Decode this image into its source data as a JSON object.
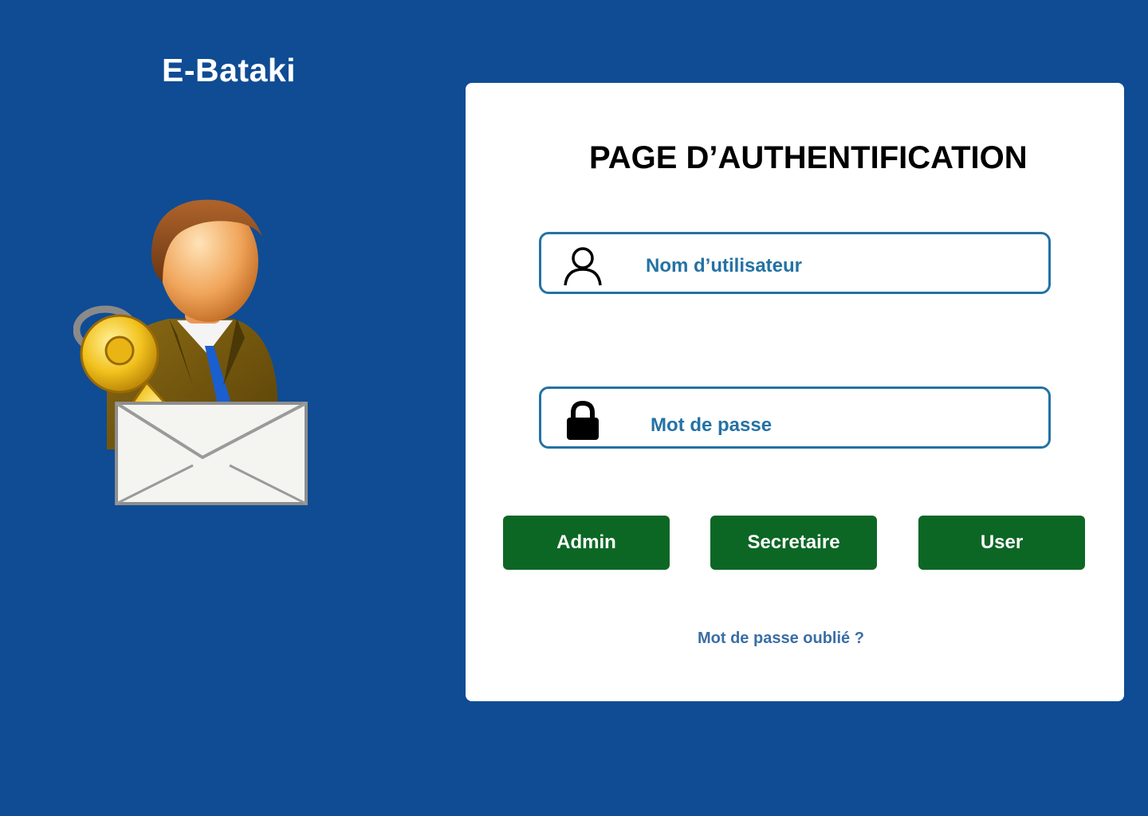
{
  "brand": {
    "name": "E-Bataki"
  },
  "login": {
    "title": "PAGE D’AUTHENTIFICATION",
    "username_placeholder": "Nom d’utilisateur",
    "password_placeholder": "Mot de passe",
    "buttons": {
      "admin": "Admin",
      "secretaire": "Secretaire",
      "user": "User"
    },
    "forgot_password": "Mot de passe oublié ?"
  },
  "icons": {
    "illustration": "user-key-mail-icon",
    "username": "user-icon",
    "password": "lock-icon"
  },
  "colors": {
    "background": "#0f4c94",
    "card": "#ffffff",
    "field_border": "#2472a4",
    "button": "#0c6725",
    "link": "#3a6ea5"
  }
}
